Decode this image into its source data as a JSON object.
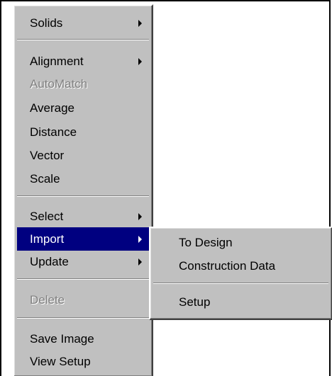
{
  "main_menu": {
    "items": [
      {
        "label": "Solids",
        "submenu": true,
        "disabled": false
      },
      {
        "label": "Alignment",
        "submenu": true,
        "disabled": false
      },
      {
        "label": "AutoMatch",
        "submenu": false,
        "disabled": true
      },
      {
        "label": "Average",
        "submenu": false,
        "disabled": false
      },
      {
        "label": "Distance",
        "submenu": false,
        "disabled": false
      },
      {
        "label": "Vector",
        "submenu": false,
        "disabled": false
      },
      {
        "label": "Scale",
        "submenu": false,
        "disabled": false
      },
      {
        "label": "Select",
        "submenu": true,
        "disabled": false
      },
      {
        "label": "Import",
        "submenu": true,
        "disabled": false,
        "selected": true
      },
      {
        "label": "Update",
        "submenu": true,
        "disabled": false
      },
      {
        "label": "Delete",
        "submenu": false,
        "disabled": true
      },
      {
        "label": "Save Image",
        "submenu": false,
        "disabled": false
      },
      {
        "label": "View Setup",
        "submenu": false,
        "disabled": false
      }
    ]
  },
  "import_submenu": {
    "items": [
      {
        "label": "To Design"
      },
      {
        "label": "Construction Data"
      },
      {
        "label": "Setup"
      }
    ]
  },
  "colors": {
    "menu_face": "#c0c0c0",
    "highlight": "#000080",
    "disabled_text": "#808080"
  }
}
